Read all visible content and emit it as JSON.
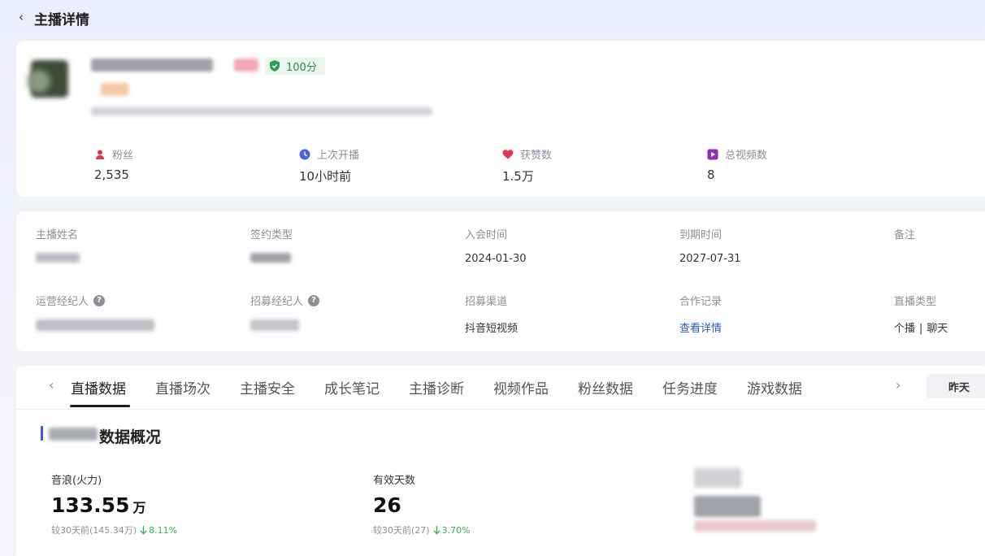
{
  "header": {
    "title": "主播详情"
  },
  "profile": {
    "score": "100分"
  },
  "stats": [
    {
      "label": "粉丝",
      "value": "2,535",
      "icon": "user-icon",
      "color": "#d9394d"
    },
    {
      "label": "上次开播",
      "value": "10小时前",
      "icon": "clock-icon",
      "color": "#4a63d8"
    },
    {
      "label": "获赞数",
      "value": "1.5万",
      "icon": "heart-icon",
      "color": "#e0355a"
    },
    {
      "label": "总视频数",
      "value": "8",
      "icon": "video-icon",
      "color": "#8e2fb5"
    }
  ],
  "info": {
    "name_label": "主播姓名",
    "contract_label": "签约类型",
    "join_label": "入会时间",
    "join_value": "2024-01-30",
    "expire_label": "到期时间",
    "expire_value": "2027-07-31",
    "remark_label": "备注",
    "ops_agent_label": "运营经纪人",
    "recruit_agent_label": "招募经纪人",
    "channel_label": "招募渠道",
    "channel_value": "抖音短视频",
    "coop_label": "合作记录",
    "coop_link": "查看详情",
    "live_type_label": "直播类型",
    "live_type_values": [
      "个播",
      "聊天"
    ]
  },
  "tabs": [
    {
      "label": "直播数据",
      "active": true
    },
    {
      "label": "直播场次"
    },
    {
      "label": "主播安全"
    },
    {
      "label": "成长笔记"
    },
    {
      "label": "主播诊断"
    },
    {
      "label": "视频作品"
    },
    {
      "label": "粉丝数据"
    },
    {
      "label": "任务进度"
    },
    {
      "label": "游戏数据"
    }
  ],
  "date_filter": "昨天",
  "section": {
    "title": "数据概况"
  },
  "metrics": [
    {
      "label": "音浪(火力)",
      "value": "133.55",
      "unit": "万",
      "compare": "较30天前(145.34万)",
      "change": "8.11%"
    },
    {
      "label": "有效天数",
      "value": "26",
      "unit": "",
      "compare": "较30天前(27)",
      "change": "3.70%"
    }
  ]
}
